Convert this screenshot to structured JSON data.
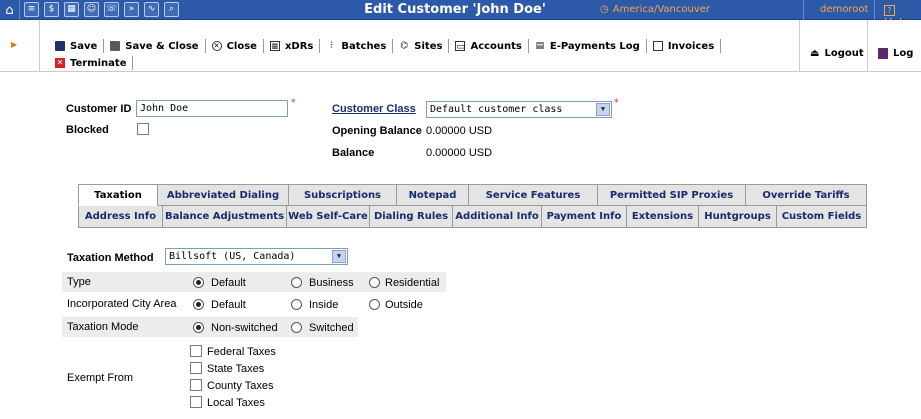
{
  "topbar": {
    "title": "Edit Customer 'John Doe'",
    "timezone": "America/Vancouver",
    "user": "demoroot",
    "help_label": "Help",
    "icons": [
      "home-icon",
      "list-icon",
      "dollar-icon",
      "grid-icon",
      "person-icon",
      "phone-icon",
      "forward-icon",
      "chart-icon",
      "search-icon"
    ]
  },
  "toolbar": {
    "save": "Save",
    "save_close": "Save & Close",
    "close": "Close",
    "xdrs": "xDRs",
    "batches": "Batches",
    "sites": "Sites",
    "accounts": "Accounts",
    "epayments": "E-Payments Log",
    "invoices": "Invoices",
    "terminate": "Terminate",
    "logout": "Logout",
    "log": "Log"
  },
  "customer": {
    "id_label": "Customer ID",
    "id_value": "John Doe",
    "blocked_label": "Blocked",
    "class_label": "Customer Class",
    "class_value": "Default customer class",
    "opening_balance_label": "Opening Balance",
    "opening_balance_value": "0.00000 USD",
    "balance_label": "Balance",
    "balance_value": "0.00000 USD"
  },
  "tabs": {
    "row1": [
      "Taxation",
      "Abbreviated Dialing",
      "Subscriptions",
      "Notepad",
      "Service Features",
      "Permitted SIP Proxies",
      "Override Tariffs"
    ],
    "row2": [
      "Address Info",
      "Balance Adjustments",
      "Web Self-Care",
      "Dialing Rules",
      "Additional Info",
      "Payment Info",
      "Extensions",
      "Huntgroups",
      "Custom Fields"
    ],
    "active": "Taxation"
  },
  "taxation": {
    "method_label": "Taxation Method",
    "method_value": "Billsoft (US, Canada)",
    "type_label": "Type",
    "type_options": [
      "Default",
      "Business",
      "Residential"
    ],
    "type_selected": "Default",
    "city_label": "Incorporated City Area",
    "city_options": [
      "Default",
      "Inside",
      "Outside"
    ],
    "city_selected": "Default",
    "mode_label": "Taxation Mode",
    "mode_options": [
      "Non-switched",
      "Switched"
    ],
    "mode_selected": "Non-switched",
    "exempt_label": "Exempt From",
    "exempt_options": [
      "Federal Taxes",
      "State Taxes",
      "County Taxes",
      "Local Taxes"
    ]
  }
}
